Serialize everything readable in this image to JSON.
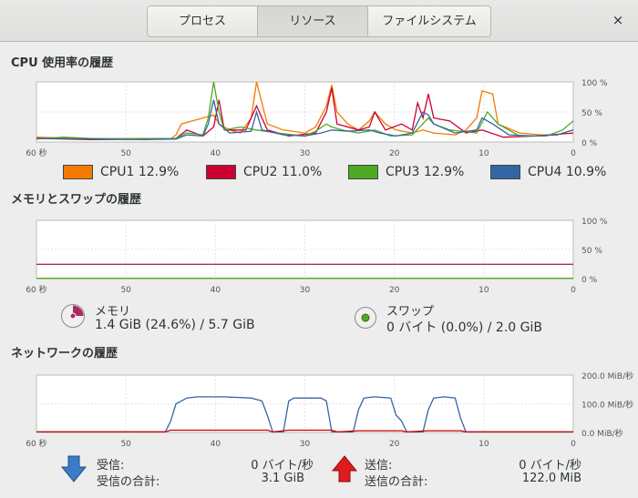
{
  "tabs": [
    {
      "label": "プロセス",
      "active": false
    },
    {
      "label": "リソース",
      "active": true
    },
    {
      "label": "ファイルシステム",
      "active": false
    }
  ],
  "close_icon": "×",
  "cpu": {
    "title": "CPU 使用率の履歴",
    "y_ticks": [
      "100 %",
      "50 %",
      "0 %"
    ],
    "x_ticks": [
      "60 秒",
      "50",
      "40",
      "30",
      "20",
      "10",
      "0"
    ],
    "legend": [
      {
        "label": "CPU1",
        "value": "12.9%",
        "color": "#f57900"
      },
      {
        "label": "CPU2",
        "value": "11.0%",
        "color": "#cc0033"
      },
      {
        "label": "CPU3",
        "value": "12.9%",
        "color": "#4eaa25"
      },
      {
        "label": "CPU4",
        "value": "10.9%",
        "color": "#3465a4"
      }
    ]
  },
  "memory": {
    "title": "メモリとスワップの履歴",
    "y_ticks": [
      "100 %",
      "50 %",
      "0 %"
    ],
    "x_ticks": [
      "60 秒",
      "50",
      "40",
      "30",
      "20",
      "10",
      "0"
    ],
    "mem_label": "メモリ",
    "mem_value": "1.4 GiB (24.6%) / 5.7 GiB",
    "mem_color": "#ad2a5f",
    "swap_label": "スワップ",
    "swap_value": "0 バイト (0.0%) / 2.0 GiB",
    "swap_color": "#4eaa25"
  },
  "network": {
    "title": "ネットワークの履歴",
    "y_ticks": [
      "200.0 MiB/秒",
      "100.0 MiB/秒",
      "0.0 MiB/秒"
    ],
    "x_ticks": [
      "60 秒",
      "50",
      "40",
      "30",
      "20",
      "10",
      "0"
    ],
    "recv_label": "受信:",
    "recv_value": "0 バイト/秒",
    "recv_total_label": "受信の合計:",
    "recv_total_value": "3.1 GiB",
    "send_label": "送信:",
    "send_value": "0 バイト/秒",
    "send_total_label": "送信の合計:",
    "send_total_value": "122.0 MiB",
    "recv_color": "#3465a4",
    "send_color": "#cc0000"
  }
}
